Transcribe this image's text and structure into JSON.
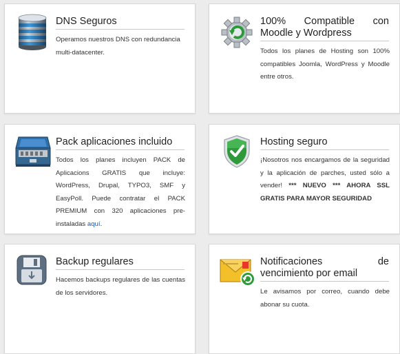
{
  "cards": [
    {
      "title": "DNS Seguros",
      "icon": "database-icon",
      "desc": "Operamos nuestros DNS con redundancia multi-datacenter."
    },
    {
      "title": "100% Compatible con Moodle y Wordpress",
      "icon": "gear-refresh-icon",
      "desc": "Todos los planes de Hosting son 100% compatibles Joomla, WordPress y Moodle entre otros."
    },
    {
      "title": "Pack aplicaciones incluido",
      "icon": "toolbox-icon",
      "desc": "Todos los planes incluyen PACK de Aplicacions GRATIS que incluye: WordPress, Drupal, TYPO3, SMF y EasyPoll. Puede contratar el PACK PREMIUM con 320 aplicaciones pre-instaladas",
      "link": "aquí",
      "after_link": "."
    },
    {
      "title": "Hosting seguro",
      "icon": "shield-check-icon",
      "desc": "¡Nosotros nos encargamos de la seguridad y la aplicación de parches, usted sólo a vender!",
      "bold": "*** NUEVO *** AHORA SSL GRATIS PARA MAYOR SEGURIDAD"
    },
    {
      "title": "Backup regulares",
      "icon": "floppy-disk-icon",
      "desc": "Hacemos backups regulares de las cuentas de los servidores."
    },
    {
      "title": "Notificaciones de vencimiento por email",
      "icon": "envelope-refresh-icon",
      "desc": "Le avisamos por correo, cuando debe abonar su cuota."
    }
  ]
}
